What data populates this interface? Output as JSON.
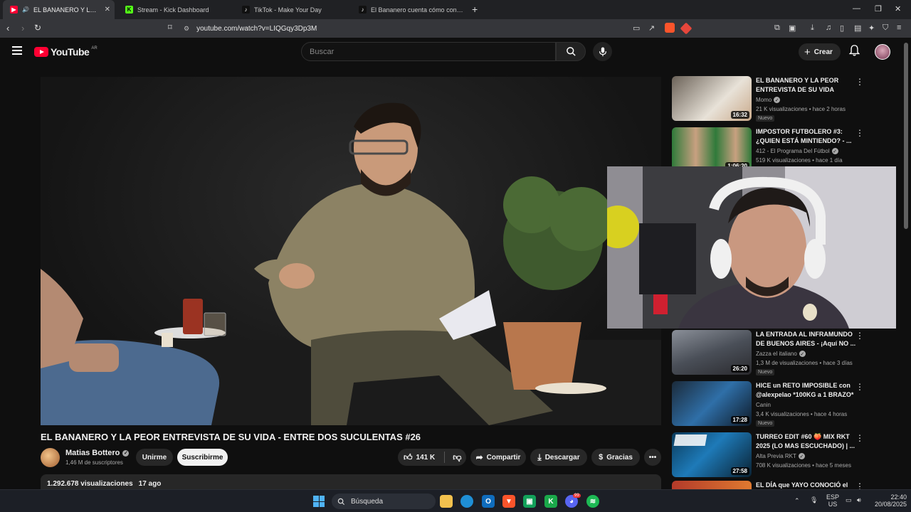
{
  "browser": {
    "tabs": [
      {
        "title": "EL BANANERO Y LA PEOR EN",
        "active": true
      },
      {
        "title": "Stream - Kick Dashboard"
      },
      {
        "title": "TikTok - Make Your Day"
      },
      {
        "title": "El Bananero cuenta cómo conoció a"
      }
    ],
    "new_tab": "+",
    "url": "youtube.com/watch?v=LIQGqy3Dp3M",
    "window_controls": [
      "—",
      "❐",
      "✕"
    ]
  },
  "youtube": {
    "logo_text": "YouTube",
    "region": "AR",
    "search_placeholder": "Buscar",
    "create_label": "Crear"
  },
  "video": {
    "title": "EL BANANERO Y LA PEOR ENTREVISTA DE SU VIDA - ENTRE DOS SUCULENTAS #26",
    "channel": "Matias Bottero",
    "subscribers": "1,46 M de suscriptores",
    "join_label": "Unirme",
    "subscribe_label": "Suscribirme",
    "likes": "141 K",
    "share_label": "Compartir",
    "download_label": "Descargar",
    "thanks_label": "Gracias",
    "views": "1.292.678 visualizaciones",
    "uploaded": "17 ago"
  },
  "recommendations": [
    {
      "title": "EL BANANERO Y LA PEOR ENTREVISTA DE SU VIDA",
      "channel": "Momo",
      "verified": true,
      "stats": "21 K visualizaciones • hace 2 horas",
      "duration": "16:32",
      "badge": "Nuevo"
    },
    {
      "title": "IMPOSTOR FUTBOLERO #3: ¿QUIEN ESTÁ MINTIENDO? - ...",
      "channel": "412 - El Programa Del Fútbol",
      "verified": true,
      "stats": "519 K visualizaciones • hace 1 día",
      "duration": "1:06:20",
      "badge": ""
    },
    {
      "title": "LA ENTRADA AL INFRAMUNDO DE BUENOS AIRES - ¡Aquí NO ...",
      "channel": "Zazza el italiano",
      "verified": true,
      "stats": "1,3 M de visualizaciones • hace 3 días",
      "duration": "26:20",
      "badge": "Nuevo"
    },
    {
      "title": "HICE un RETO IMPOSIBLE con @alexpelao *100KG a 1 BRAZO*",
      "channel": "Canin",
      "verified": false,
      "stats": "3,4 K visualizaciones • hace 4 horas",
      "duration": "17:28",
      "badge": "Nuevo"
    },
    {
      "title": "TURREO EDIT #60 🍑 MIX RKT 2025 (LO MAS ESCUCHADO) | ...",
      "channel": "Alta Previa RKT",
      "verified": true,
      "stats": "708 K visualizaciones • hace 5 meses",
      "duration": "27:58",
      "badge": ""
    },
    {
      "title": "EL DÍA que YAYO CONOCIÓ el",
      "channel": "",
      "verified": false,
      "stats": "",
      "duration": "",
      "badge": ""
    }
  ],
  "taskbar": {
    "search_placeholder": "Búsqueda",
    "lang_top": "ESP",
    "lang_bottom": "US",
    "time": "22:40",
    "date": "20/08/2025",
    "discord_badge": "99"
  },
  "colors": {
    "youtube_red": "#ff0033",
    "background": "#0f0f0f",
    "pill": "#272727"
  }
}
